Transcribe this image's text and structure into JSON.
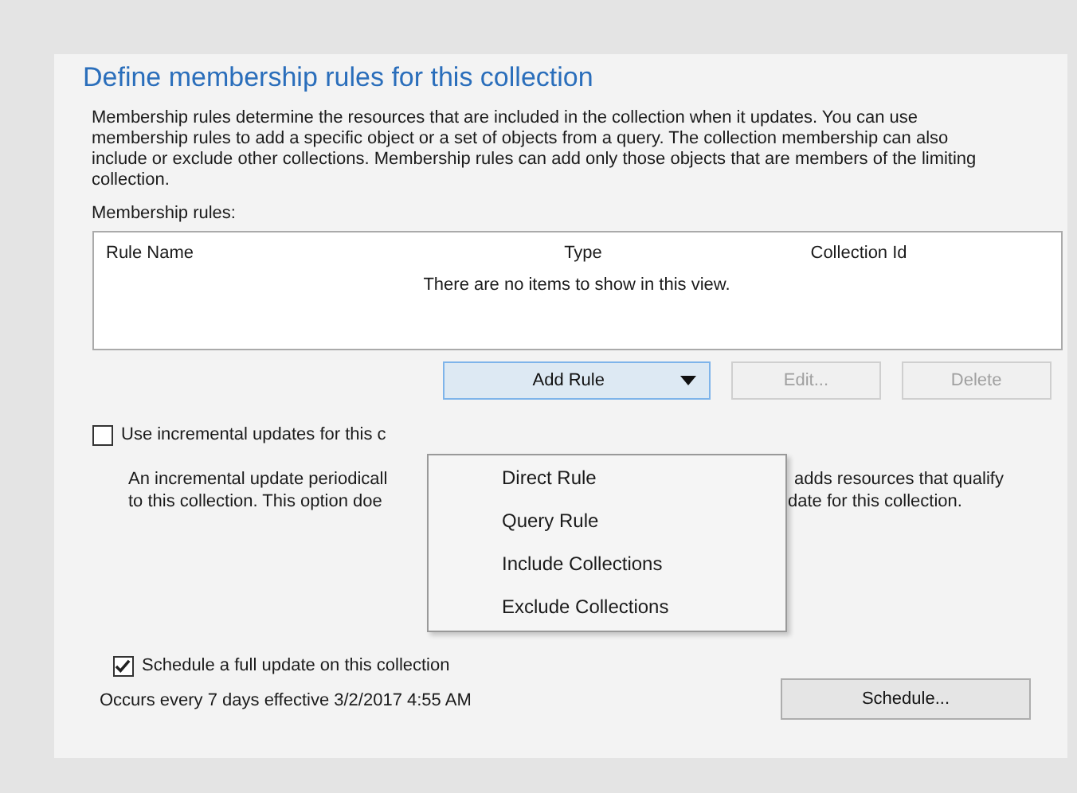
{
  "title": "Define membership rules for this collection",
  "description": "Membership rules determine the resources that are included in the collection when it updates. You can use membership rules to add a specific object or a set of objects from a query. The collection membership can also include or exclude other collections. Membership rules can add only those objects that are members of the limiting collection.",
  "rules_label": "Membership rules:",
  "rules_list": {
    "columns": [
      "Rule Name",
      "Type",
      "Collection Id"
    ],
    "empty_message": "There are no items to show in this view."
  },
  "buttons": [
    {
      "label": "Add Rule",
      "kind": "dropdown",
      "disabled": false
    },
    {
      "label": "Edit...",
      "kind": "plain",
      "disabled": true
    },
    {
      "label": "Delete",
      "kind": "plain",
      "disabled": true
    }
  ],
  "incremental": {
    "checked": false,
    "label": "Use incremental updates for this c",
    "description_left": [
      "An incremental update periodicall",
      "to this collection. This option doe"
    ],
    "description_right": [
      "adds resources that qualify",
      "date for this collection."
    ]
  },
  "add_rule_menu": [
    "Direct Rule",
    "Query Rule",
    "Include Collections",
    "Exclude Collections"
  ],
  "schedule": {
    "checked": true,
    "label": "Schedule a full update on this collection",
    "occurs": "Occurs every 7 days effective 3/2/2017 4:55 AM",
    "button": "Schedule..."
  }
}
